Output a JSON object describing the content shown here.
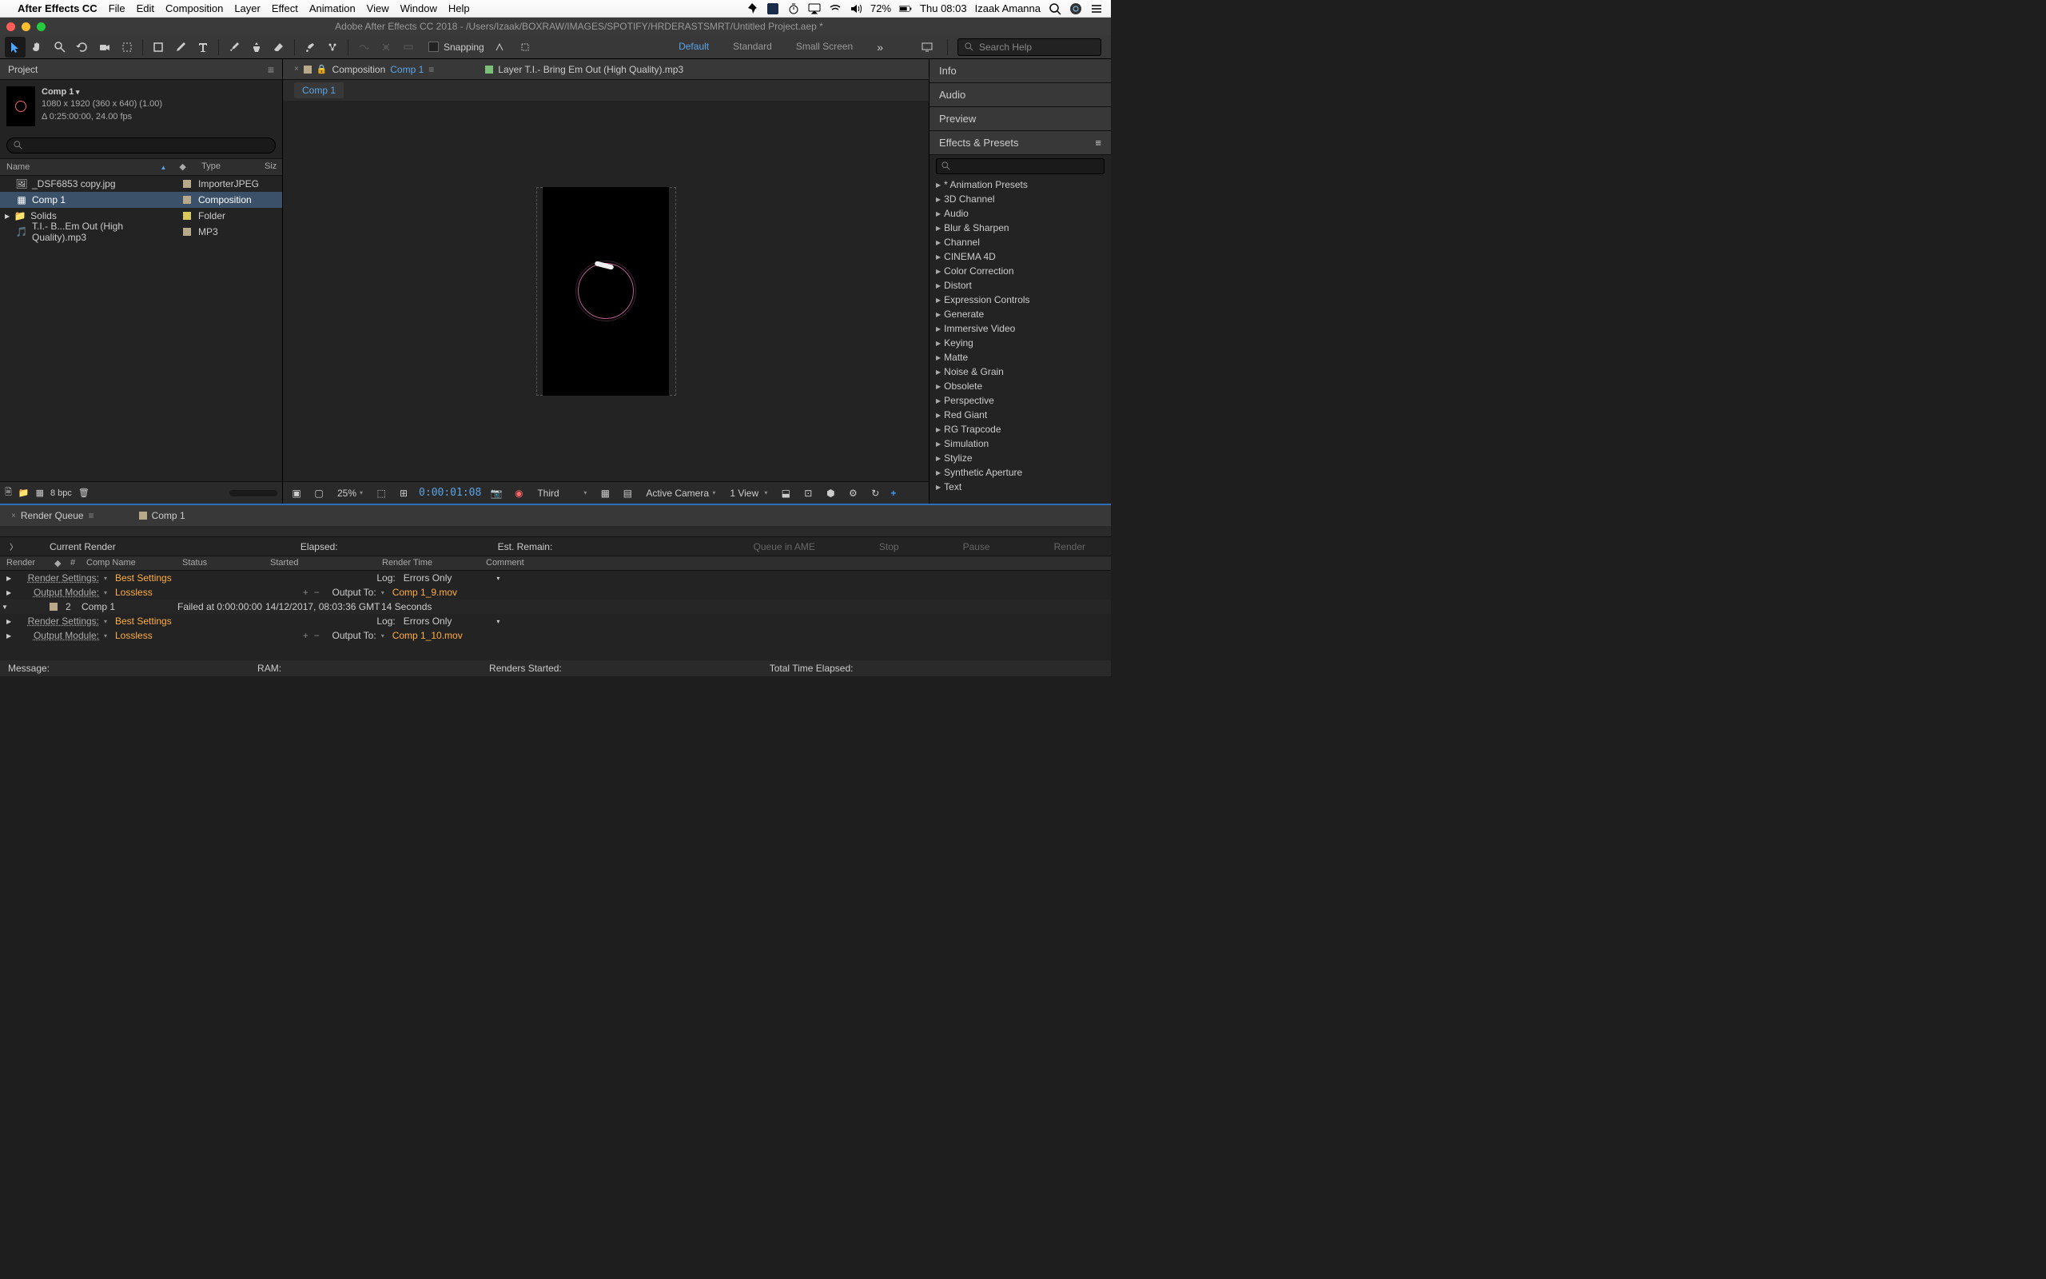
{
  "menubar": {
    "app": "After Effects CC",
    "items": [
      "File",
      "Edit",
      "Composition",
      "Layer",
      "Effect",
      "Animation",
      "View",
      "Window",
      "Help"
    ],
    "battery": "72%",
    "clock": "Thu 08:03",
    "user": "Izaak Amanna"
  },
  "window": {
    "title": "Adobe After Effects CC 2018 - /Users/Izaak/BOXRAW/IMAGES/SPOTIFY/HRDERASTSMRT/Untitled Project.aep *"
  },
  "toolbar": {
    "snapping": "Snapping",
    "workspaces": {
      "default": "Default",
      "standard": "Standard",
      "small": "Small Screen"
    },
    "search_placeholder": "Search Help"
  },
  "project": {
    "panel_title": "Project",
    "comp": {
      "name": "Comp 1",
      "dims": "1080 x 1920  (360 x 640) (1.00)",
      "duration": "Δ 0:25:00:00, 24.00 fps"
    },
    "headers": {
      "name": "Name",
      "type": "Type",
      "size": "Siz"
    },
    "rows": [
      {
        "name": "_DSF6853 copy.jpg",
        "type": "ImporterJPEG",
        "tag": "#b8a98a",
        "icon": "image"
      },
      {
        "name": "Comp 1",
        "type": "Composition",
        "tag": "#b8a98a",
        "icon": "comp",
        "selected": true
      },
      {
        "name": "Solids",
        "type": "Folder",
        "tag": "#d8c95a",
        "icon": "folder",
        "expand": true
      },
      {
        "name": "T.I.- B...Em Out (High Quality).mp3",
        "type": "MP3",
        "tag": "#b8a98a",
        "icon": "audio"
      }
    ],
    "footer_bpc": "8 bpc"
  },
  "viewer": {
    "comp_tab_prefix": "Composition",
    "comp_tab_name": "Comp 1",
    "layer_tab": "Layer T.I.- Bring Em Out (High Quality).mp3",
    "flow": "Comp 1",
    "footer": {
      "zoom": "25%",
      "time": "0:00:01:08",
      "res": "Third",
      "camera": "Active Camera",
      "view": "1 View"
    }
  },
  "right": {
    "panels": [
      "Info",
      "Audio",
      "Preview"
    ],
    "ep_title": "Effects & Presets",
    "ep_items": [
      "* Animation Presets",
      "3D Channel",
      "Audio",
      "Blur & Sharpen",
      "Channel",
      "CINEMA 4D",
      "Color Correction",
      "Distort",
      "Expression Controls",
      "Generate",
      "Immersive Video",
      "Keying",
      "Matte",
      "Noise & Grain",
      "Obsolete",
      "Perspective",
      "Red Giant",
      "RG Trapcode",
      "Simulation",
      "Stylize",
      "Synthetic Aperture",
      "Text"
    ]
  },
  "render": {
    "tab1": "Render Queue",
    "tab2": "Comp 1",
    "current": "Current Render",
    "elapsed": "Elapsed:",
    "remain": "Est. Remain:",
    "buttons": {
      "ame": "Queue in AME",
      "stop": "Stop",
      "pause": "Pause",
      "render": "Render"
    },
    "headers": {
      "render": "Render",
      "num": "#",
      "comp": "Comp Name",
      "status": "Status",
      "started": "Started",
      "rtime": "Render Time",
      "comment": "Comment"
    },
    "item": {
      "rs_label": "Render Settings:",
      "rs_val": "Best Settings",
      "om_label": "Output Module:",
      "om_val": "Lossless",
      "log_label": "Log:",
      "log_val": "Errors Only",
      "out_label": "Output To:",
      "out_val1": "Comp 1_9.mov",
      "num": "2",
      "comp": "Comp 1",
      "status": "Failed at 0:00:00:00",
      "started": "14/12/2017, 08:03:36 GMT",
      "rtime": "14 Seconds",
      "out_val2": "Comp 1_10.mov"
    },
    "footer": {
      "msg": "Message:",
      "ram": "RAM:",
      "started": "Renders Started:",
      "total": "Total Time Elapsed:"
    }
  }
}
